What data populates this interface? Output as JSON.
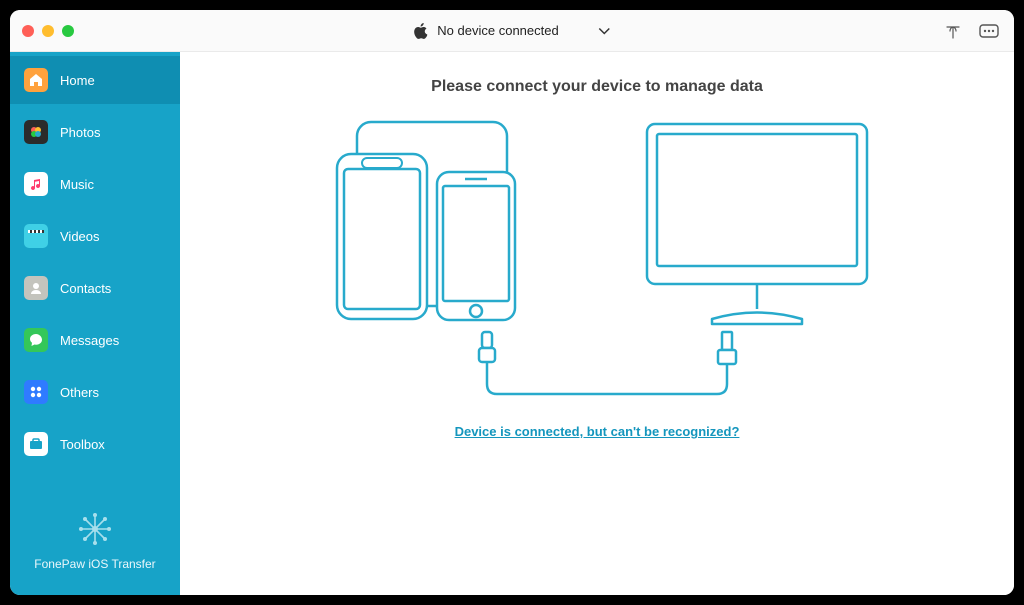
{
  "header": {
    "device_status": "No device connected"
  },
  "sidebar": {
    "items": [
      {
        "label": "Home",
        "icon": "home",
        "active": true
      },
      {
        "label": "Photos",
        "icon": "photos",
        "active": false
      },
      {
        "label": "Music",
        "icon": "music",
        "active": false
      },
      {
        "label": "Videos",
        "icon": "videos",
        "active": false
      },
      {
        "label": "Contacts",
        "icon": "contacts",
        "active": false
      },
      {
        "label": "Messages",
        "icon": "messages",
        "active": false
      },
      {
        "label": "Others",
        "icon": "others",
        "active": false
      },
      {
        "label": "Toolbox",
        "icon": "toolbox",
        "active": false
      }
    ],
    "footer": "FonePaw iOS Transfer"
  },
  "main": {
    "headline": "Please connect your device to manage data",
    "help_link": "Device is connected, but can't be recognized?"
  },
  "colors": {
    "sidebar": "#17a3c8",
    "sidebar_active": "#0f8eb2",
    "accent": "#28aacc"
  }
}
